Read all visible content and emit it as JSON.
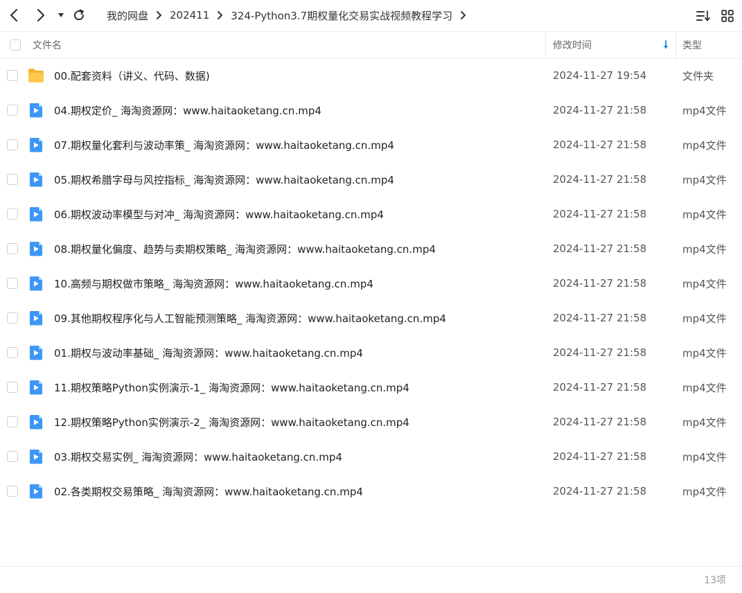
{
  "toolbar": {
    "breadcrumb": [
      "我的网盘",
      "202411",
      "324-Python3.7期权量化交易实战视频教程学习"
    ]
  },
  "header": {
    "col_name": "文件名",
    "col_modified": "修改时间",
    "col_type": "类型"
  },
  "files": [
    {
      "name": "00.配套资料（讲义、代码、数据)",
      "modified": "2024-11-27 19:54",
      "type": "文件夹",
      "icon": "folder-icon"
    },
    {
      "name": "04.期权定价_ 海淘资源网：www.haitaoketang.cn.mp4",
      "modified": "2024-11-27 21:58",
      "type": "mp4文件",
      "icon": "video-file-icon"
    },
    {
      "name": "07.期权量化套利与波动率策_ 海淘资源网：www.haitaoketang.cn.mp4",
      "modified": "2024-11-27 21:58",
      "type": "mp4文件",
      "icon": "video-file-icon"
    },
    {
      "name": "05.期权希腊字母与风控指标_ 海淘资源网：www.haitaoketang.cn.mp4",
      "modified": "2024-11-27 21:58",
      "type": "mp4文件",
      "icon": "video-file-icon"
    },
    {
      "name": "06.期权波动率模型与对冲_ 海淘资源网：www.haitaoketang.cn.mp4",
      "modified": "2024-11-27 21:58",
      "type": "mp4文件",
      "icon": "video-file-icon"
    },
    {
      "name": "08.期权量化偏度、趋势与卖期权策略_ 海淘资源网：www.haitaoketang.cn.mp4",
      "modified": "2024-11-27 21:58",
      "type": "mp4文件",
      "icon": "video-file-icon"
    },
    {
      "name": "10.高频与期权做市策略_ 海淘资源网：www.haitaoketang.cn.mp4",
      "modified": "2024-11-27 21:58",
      "type": "mp4文件",
      "icon": "video-file-icon"
    },
    {
      "name": "09.其他期权程序化与人工智能预测策略_ 海淘资源网：www.haitaoketang.cn.mp4",
      "modified": "2024-11-27 21:58",
      "type": "mp4文件",
      "icon": "video-file-icon"
    },
    {
      "name": "01.期权与波动率基础_ 海淘资源网：www.haitaoketang.cn.mp4",
      "modified": "2024-11-27 21:58",
      "type": "mp4文件",
      "icon": "video-file-icon"
    },
    {
      "name": "11.期权策略Python实例演示-1_ 海淘资源网：www.haitaoketang.cn.mp4",
      "modified": "2024-11-27 21:58",
      "type": "mp4文件",
      "icon": "video-file-icon"
    },
    {
      "name": "12.期权策略Python实例演示-2_ 海淘资源网：www.haitaoketang.cn.mp4",
      "modified": "2024-11-27 21:58",
      "type": "mp4文件",
      "icon": "video-file-icon"
    },
    {
      "name": "03.期权交易实例_ 海淘资源网：www.haitaoketang.cn.mp4",
      "modified": "2024-11-27 21:58",
      "type": "mp4文件",
      "icon": "video-file-icon"
    },
    {
      "name": "02.各类期权交易策略_ 海淘资源网：www.haitaoketang.cn.mp4",
      "modified": "2024-11-27 21:58",
      "type": "mp4文件",
      "icon": "video-file-icon"
    }
  ],
  "footer": {
    "item_count": "13项"
  },
  "colors": {
    "accent": "#2b8df5",
    "folder": "#ffc23f",
    "video": "#3d97f7"
  }
}
